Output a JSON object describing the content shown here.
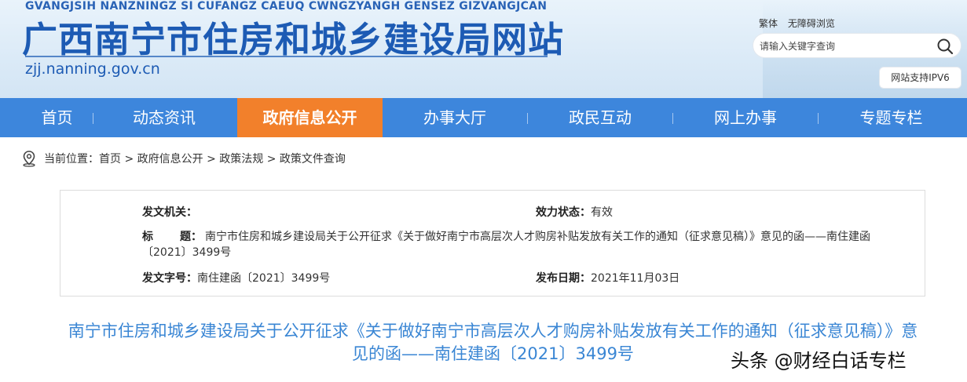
{
  "header": {
    "pinyin": "GVANGJSIH NANZNINGZ SI CUFANGZ CAEUQ CWNGZYANGH GENSEZ GIZVANGJCAN",
    "title": "广西南宁市住房和城乡建设局网站",
    "domain": "zjj.nanning.gov.cn",
    "links": [
      "繁体",
      "无障碍浏览"
    ],
    "search_placeholder": "请输入关键字查询",
    "ipv6": "网站支持IPV6",
    "search_icon": "search-icon"
  },
  "nav": {
    "items": [
      "首页",
      "动态资讯",
      "政府信息公开",
      "办事大厅",
      "政民互动",
      "网上办事",
      "专题专栏"
    ],
    "active_index": 2
  },
  "breadcrumb": {
    "prefix": "当前位置：",
    "items": [
      "首页",
      "政府信息公开",
      "政策法规",
      "政策文件查询"
    ],
    "separator": " > ",
    "icon": "location-pin-icon"
  },
  "info": {
    "issuer_label": "发文机关：",
    "issuer_value": "",
    "status_label": "效力状态：",
    "status_value": "有效",
    "title_label_1": "标",
    "title_label_2": "题：",
    "title_value": "南宁市住房和城乡建设局关于公开征求《关于做好南宁市高层次人才购房补贴发放有关工作的通知（征求意见稿）》意见的函——南住建函〔2021〕3499号",
    "docno_label": "发文字号：",
    "docno_value": "南住建函〔2021〕3499号",
    "date_label": "发布日期：",
    "date_value": "2021年11月03日"
  },
  "headline": "南宁市住房和城乡建设局关于公开征求《关于做好南宁市高层次人才购房补贴发放有关工作的通知（征求意见稿）》意见的函——南住建函〔2021〕3499号",
  "watermark": "头条 @财经白话专栏",
  "colors": {
    "brand_blue": "#1d5bb4",
    "nav_blue": "#3d86dc",
    "nav_active": "#f2802b",
    "headline_blue": "#3a86d4"
  }
}
